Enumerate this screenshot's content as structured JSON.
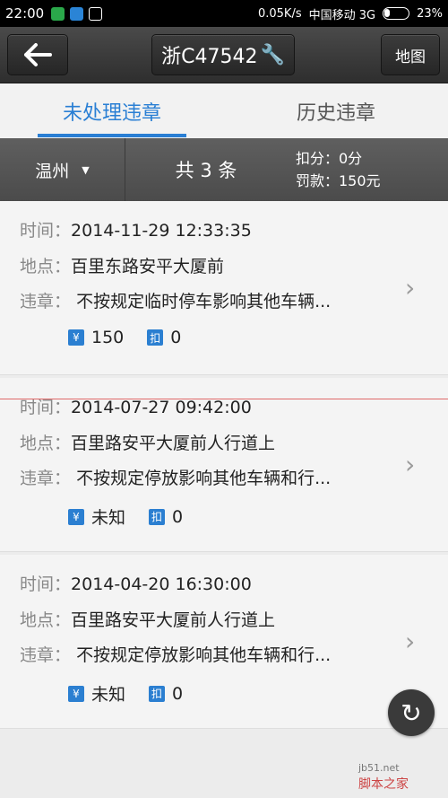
{
  "status_bar": {
    "time": "22:00",
    "network_speed": "0.05K/s",
    "carrier": "中国移动 3G",
    "battery": "23%"
  },
  "toolbar": {
    "back_icon": "←",
    "plate": "浙C47542",
    "wrench_icon": "🔧",
    "map_label": "地图"
  },
  "tabs": {
    "active": "未处理违章",
    "inactive": "历史违章"
  },
  "summary": {
    "city": "温州",
    "city_caret": "▼",
    "total": "共 3 条",
    "points": "扣分：0分",
    "fine": "罚款：150元"
  },
  "labels": {
    "time": "时间：",
    "place": "地点：",
    "violation": "违章："
  },
  "badge_icons": {
    "money": "¥",
    "points": "扣"
  },
  "violations": [
    {
      "time": "2014-11-29 12:33:35",
      "place": "百里东路安平大厦前",
      "violation": "不按规定临时停车影响其他车辆...",
      "fine": "150",
      "points": "0"
    },
    {
      "time": "2014-07-27 09:42:00",
      "place": "百里路安平大厦前人行道上",
      "violation": "不按规定停放影响其他车辆和行...",
      "fine": "未知",
      "points": "0"
    },
    {
      "time": "2014-04-20 16:30:00",
      "place": "百里路安平大厦前人行道上",
      "violation": "不按规定停放影响其他车辆和行...",
      "fine": "未知",
      "points": "0"
    }
  ],
  "chevron_icon": "›",
  "refresh_icon": "↻",
  "watermark": {
    "site": "jb51.net",
    "text": "脚本之家"
  },
  "colors": {
    "accent": "#2a7fd4",
    "toolbar": "#3a3a3a",
    "summary": "#555555"
  }
}
